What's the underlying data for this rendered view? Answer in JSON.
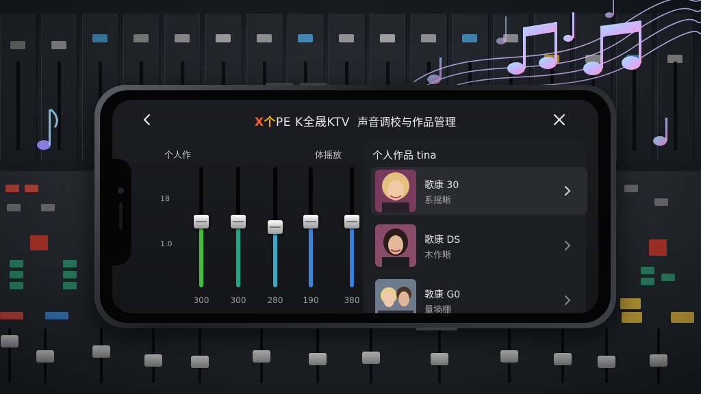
{
  "header": {
    "logo_x": "X",
    "logo_ge": "个",
    "logo_rest": "PE K全晟KTV",
    "subtitle": "声音调校与作品管理"
  },
  "equalizer": {
    "label_left": "个人作",
    "label_right": "体摇放",
    "scale_top": "18",
    "scale_mid": "1.0",
    "sliders": [
      {
        "value_label": "300",
        "level": 0.55,
        "color": "#3fbf3a"
      },
      {
        "value_label": "300",
        "level": 0.55,
        "color": "#1ea889"
      },
      {
        "value_label": "280",
        "level": 0.5,
        "color": "#3aa9c9"
      },
      {
        "value_label": "190",
        "level": 0.55,
        "color": "#3b86d9"
      },
      {
        "value_label": "380",
        "level": 0.55,
        "color": "#3a7fe0"
      }
    ]
  },
  "works": {
    "title": "个人作品 tina",
    "items": [
      {
        "name": "歌康 30",
        "sub": "系摇晰",
        "active": true
      },
      {
        "name": "歌康 DS",
        "sub": "木作晰",
        "active": false
      },
      {
        "name": "敦康 G0",
        "sub": "量墒棚",
        "active": false
      }
    ]
  },
  "colors": {
    "logo_red": "#ff5a2b",
    "logo_yellow": "#f4b400",
    "screen_bg": "#1a1b1e",
    "panel_bg": "#1d1e21"
  },
  "icons": {
    "back": "chevron-left-icon",
    "close": "close-icon",
    "item_arrow": "chevron-right-icon"
  }
}
